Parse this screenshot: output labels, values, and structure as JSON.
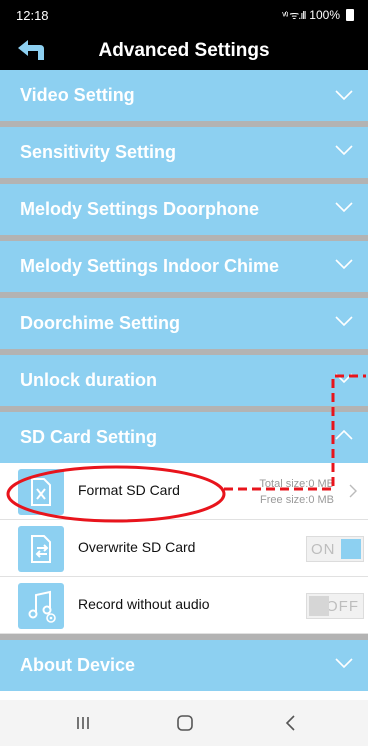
{
  "status_bar": {
    "time": "12:18",
    "signal_text": "ᵛ⁽ᶦ ᯤ.ıll",
    "battery_text": "100%"
  },
  "header": {
    "title": "Advanced Settings",
    "back_icon": "back-arrow-icon"
  },
  "sections": [
    {
      "label": "Video Setting",
      "state": "collapsed"
    },
    {
      "label": "Sensitivity Setting",
      "state": "collapsed"
    },
    {
      "label": "Melody Settings Doorphone",
      "state": "collapsed"
    },
    {
      "label": "Melody Settings Indoor Chime",
      "state": "collapsed"
    },
    {
      "label": "Doorchime Setting",
      "state": "collapsed"
    },
    {
      "label": "Unlock duration",
      "state": "collapsed"
    },
    {
      "label": "SD Card Setting",
      "state": "expanded"
    },
    {
      "label": "About Device",
      "state": "collapsed"
    }
  ],
  "sd_card_items": {
    "format": {
      "label": "Format SD Card",
      "total_size": "Total size:0 MB",
      "free_size": "Free size:0 MB",
      "icon": "format-sd-card-icon"
    },
    "overwrite": {
      "label": "Overwrite SD Card",
      "toggle": "ON",
      "icon": "overwrite-sd-card-icon"
    },
    "record_audio": {
      "label": "Record without audio",
      "toggle": "OFF",
      "icon": "music-settings-icon"
    }
  },
  "nav": {
    "recent_icon": "recent-apps-icon",
    "home_icon": "home-icon",
    "back_icon": "nav-back-icon"
  },
  "colors": {
    "accent": "#8dd0f1",
    "separator": "#b3b3b3",
    "annotation": "#e8141c"
  }
}
